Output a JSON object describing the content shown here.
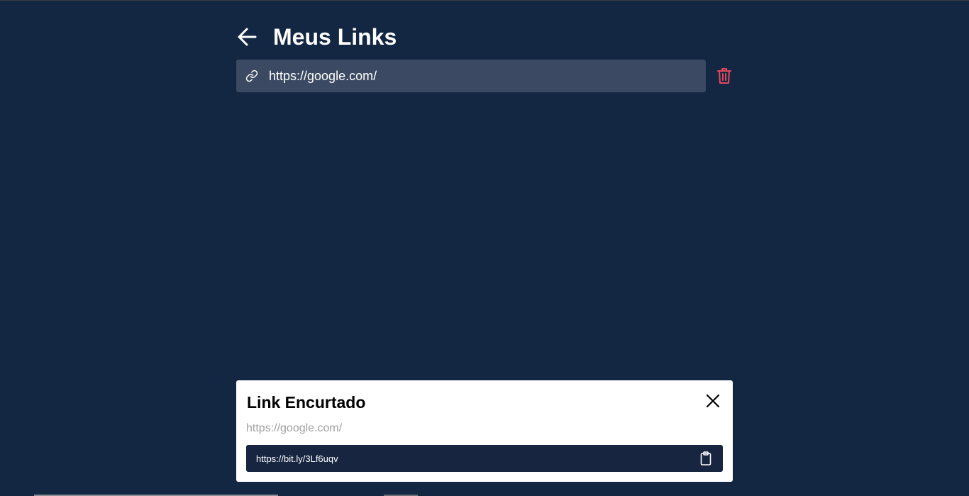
{
  "page": {
    "title": "Meus Links"
  },
  "links": [
    {
      "url": "https://google.com/"
    }
  ],
  "modal": {
    "title": "Link Encurtado",
    "original_url": "https://google.com/",
    "short_url": "https://bit.ly/3Lf6uqv"
  },
  "icons": {
    "back": "arrow-left-icon",
    "link": "link-icon",
    "delete": "trash-icon",
    "close": "close-icon",
    "copy": "clipboard-icon"
  },
  "colors": {
    "background": "#132743",
    "link_row": "#3b4a62",
    "delete": "#e5485c",
    "short_box": "#172541"
  }
}
